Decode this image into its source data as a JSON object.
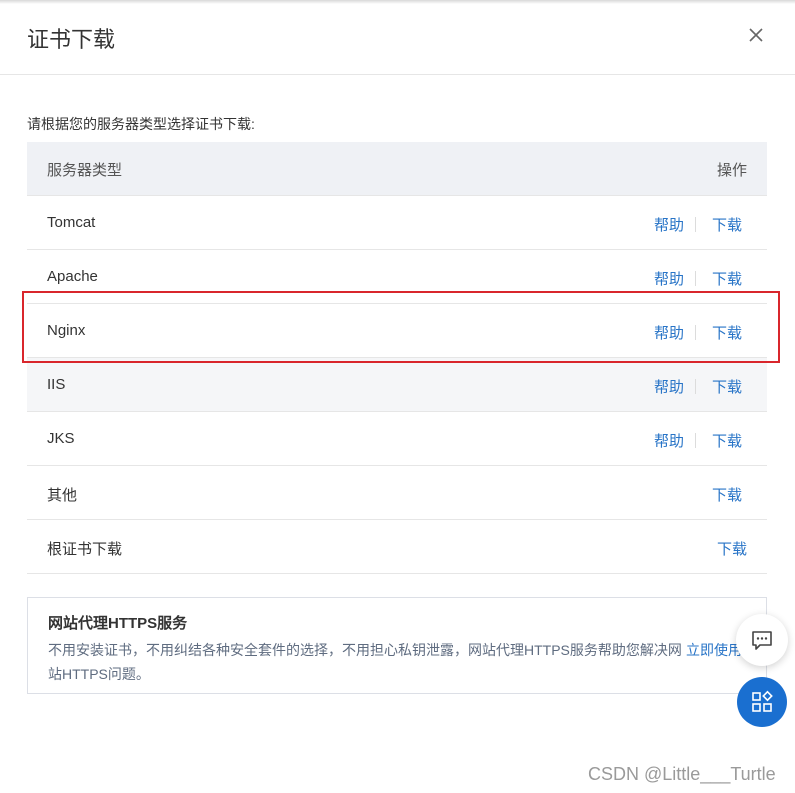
{
  "dialog": {
    "title": "证书下载",
    "close_icon": "close-icon"
  },
  "instruction": "请根据您的服务器类型选择证书下载:",
  "table": {
    "headers": {
      "type": "服务器类型",
      "operation": "操作"
    },
    "rows": [
      {
        "name": "Tomcat",
        "help": "帮助",
        "download": "下载"
      },
      {
        "name": "Apache",
        "help": "帮助",
        "download": "下载"
      },
      {
        "name": "Nginx",
        "help": "帮助",
        "download": "下载"
      },
      {
        "name": "IIS",
        "help": "帮助",
        "download": "下载"
      },
      {
        "name": "JKS",
        "help": "帮助",
        "download": "下载"
      },
      {
        "name": "其他",
        "download": "下载"
      },
      {
        "name": "根证书下载",
        "download": "下载"
      }
    ]
  },
  "promo": {
    "title": "网站代理HTTPS服务",
    "description": "不用安装证书，不用纠结各种安全套件的选择，不用担心私钥泄露，网站代理HTTPS服务帮助您解决网站HTTPS问题。",
    "link": "立即使用"
  },
  "floating": {
    "chat_icon": "chat-icon",
    "apps_icon": "apps-icon"
  },
  "watermark": "CSDN @Little___Turtle",
  "colors": {
    "link": "#2874c7",
    "highlight": "#d9262c",
    "header_bg": "#eff1f5",
    "fab_blue": "#1a6fd0"
  }
}
